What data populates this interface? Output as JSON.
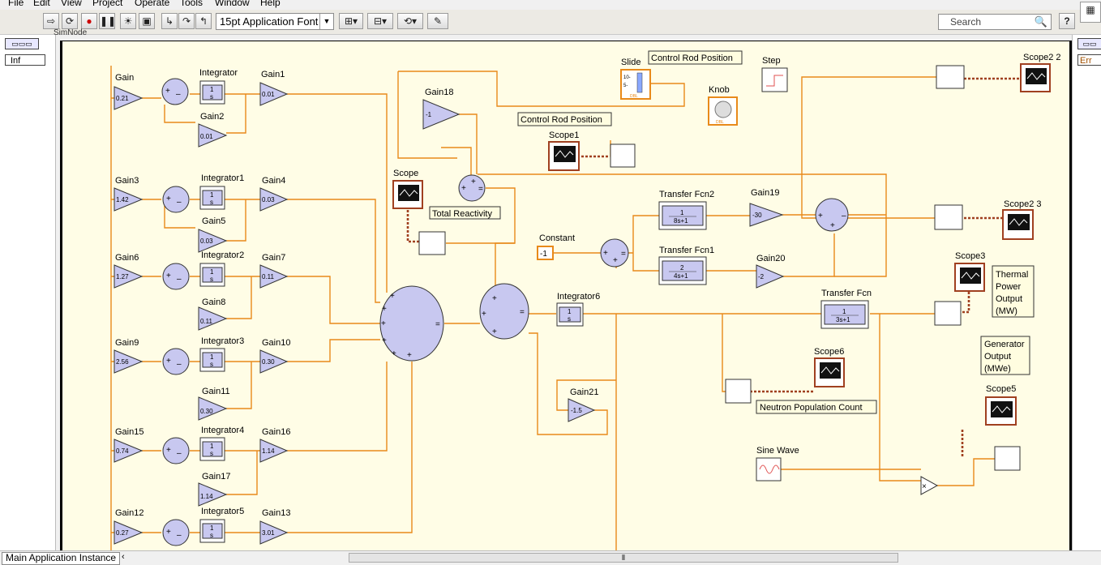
{
  "menu": [
    "File",
    "Edit",
    "View",
    "Project",
    "Operate",
    "Tools",
    "Window",
    "Help"
  ],
  "toolbar": {
    "font": "15pt Application Font",
    "search_placeholder": "Search",
    "help": "?"
  },
  "left_panel": {
    "node_label": "SimNode",
    "inf_label": "Inf"
  },
  "right_panel": {
    "err_label": "Err"
  },
  "status": {
    "app_instance": "Main Application Instance"
  },
  "colors": {
    "wire": "#e88a1a",
    "block": "#c8c8f0",
    "bg": "#fffde6",
    "scope": "#a04020"
  },
  "diagram": {
    "gains": [
      {
        "label": "Gain",
        "value": "0.21"
      },
      {
        "label": "Gain1",
        "value": "0.01"
      },
      {
        "label": "Gain2",
        "value": "0.01"
      },
      {
        "label": "Gain3",
        "value": "1.42"
      },
      {
        "label": "Gain4",
        "value": "0.03"
      },
      {
        "label": "Gain5",
        "value": "0.03"
      },
      {
        "label": "Gain6",
        "value": "1.27"
      },
      {
        "label": "Gain7",
        "value": "0.11"
      },
      {
        "label": "Gain8",
        "value": "0.11"
      },
      {
        "label": "Gain9",
        "value": "2.56"
      },
      {
        "label": "Gain10",
        "value": "0.30"
      },
      {
        "label": "Gain11",
        "value": "0.30"
      },
      {
        "label": "Gain15",
        "value": "0.74"
      },
      {
        "label": "Gain16",
        "value": "1.14"
      },
      {
        "label": "Gain17",
        "value": "1.14"
      },
      {
        "label": "Gain12",
        "value": "0.27"
      },
      {
        "label": "Gain13",
        "value": "3.01"
      },
      {
        "label": "Gain18",
        "value": "-1"
      },
      {
        "label": "Gain19",
        "value": "-30"
      },
      {
        "label": "Gain20",
        "value": "-2"
      },
      {
        "label": "Gain21",
        "value": "-1.5"
      }
    ],
    "integrators": [
      "Integrator",
      "Integrator1",
      "Integrator2",
      "Integrator3",
      "Integrator4",
      "Integrator5",
      "Integrator6"
    ],
    "integrator_num": "1",
    "integrator_den": "s",
    "transfer_fcns": [
      {
        "label": "Transfer Fcn2",
        "num": "1",
        "den": "8s+1"
      },
      {
        "label": "Transfer Fcn1",
        "num": "2",
        "den": "4s+1"
      },
      {
        "label": "Transfer Fcn",
        "num": "1",
        "den": "3s+1"
      }
    ],
    "scopes": [
      "Scope",
      "Scope1",
      "Scope2 2",
      "Scope2 3",
      "Scope3",
      "Scope5",
      "Scope6"
    ],
    "constant": {
      "label": "Constant",
      "value": "-1"
    },
    "slide": {
      "label": "Slide",
      "top": "10-",
      "mid": "5-",
      "tag": "DBL"
    },
    "knob": {
      "label": "Knob",
      "tag": "DBL"
    },
    "step": "Step",
    "sine": "Sine Wave",
    "annotations": {
      "control_rod_1": "Control Rod Position",
      "control_rod_2": "Control Rod Position",
      "total_reactivity": "Total Reactivity",
      "neutron": "Neutron Population Count",
      "thermal": [
        "Thermal",
        "Power",
        "Output",
        "(MW)"
      ],
      "generator": [
        "Generator",
        "Output",
        "(MWe)"
      ]
    }
  }
}
